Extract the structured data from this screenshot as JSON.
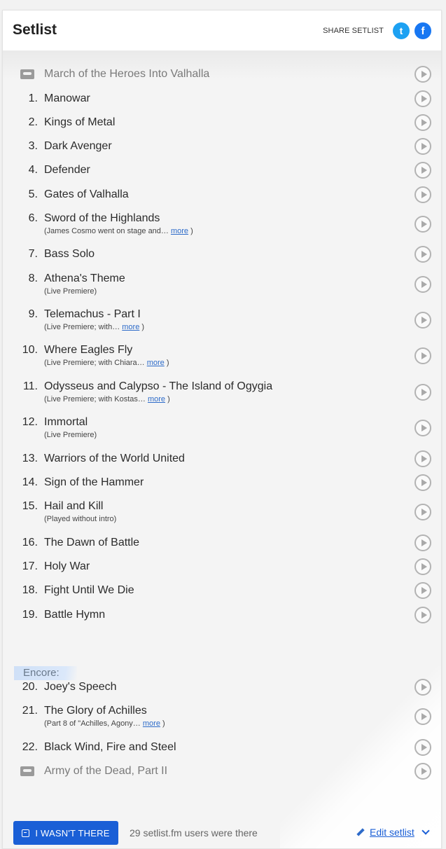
{
  "header": {
    "title": "Setlist",
    "share_label": "SHARE SETLIST",
    "twitter_icon": "t",
    "facebook_icon": "f"
  },
  "setlist": [
    {
      "tape": true,
      "song": "March of the Heroes Into Valhalla"
    },
    {
      "number": "1.",
      "song": "Manowar"
    },
    {
      "number": "2.",
      "song": "Kings of Metal"
    },
    {
      "number": "3.",
      "song": "Dark Avenger"
    },
    {
      "number": "4.",
      "song": "Defender"
    },
    {
      "number": "5.",
      "song": "Gates of Valhalla"
    },
    {
      "number": "6.",
      "song": "Sword of the Highlands",
      "note": "(James Cosmo went on stage and…",
      "more": "more",
      "note_end": ")"
    },
    {
      "number": "7.",
      "song": "Bass Solo"
    },
    {
      "number": "8.",
      "song": "Athena's Theme",
      "note": "(Live Premiere)"
    },
    {
      "number": "9.",
      "song": "Telemachus - Part I",
      "note": "(Live Premiere; with…",
      "more": "more",
      "note_end": ")"
    },
    {
      "number": "10.",
      "song": "Where Eagles Fly",
      "note": "(Live Premiere; with Chiara…",
      "more": "more",
      "note_end": ")"
    },
    {
      "number": "11.",
      "song": "Odysseus and Calypso - The Island of Ogygia",
      "note": "(Live Premiere; with Kostas…",
      "more": "more",
      "note_end": ")"
    },
    {
      "number": "12.",
      "song": "Immortal",
      "note": "(Live Premiere)"
    },
    {
      "number": "13.",
      "song": "Warriors of the World United"
    },
    {
      "number": "14.",
      "song": "Sign of the Hammer"
    },
    {
      "number": "15.",
      "song": "Hail and Kill",
      "note": "(Played without intro)"
    },
    {
      "number": "16.",
      "song": "The Dawn of Battle"
    },
    {
      "number": "17.",
      "song": "Holy War"
    },
    {
      "number": "18.",
      "song": "Fight Until We Die"
    },
    {
      "number": "19.",
      "song": "Battle Hymn"
    }
  ],
  "encore_label": "Encore:",
  "encore": [
    {
      "number": "20.",
      "song": "Joey's Speech"
    },
    {
      "number": "21.",
      "song": "The Glory of Achilles",
      "note": "(Part 8 of \"Achilles, Agony…",
      "more": "more",
      "note_end": ")"
    },
    {
      "number": "22.",
      "song": "Black Wind, Fire and Steel"
    },
    {
      "tape": true,
      "song": "Army of the Dead, Part II"
    }
  ],
  "footer": {
    "wasnt_there_label": "I WASN'T THERE",
    "attendance_text": "29 setlist.fm users were there",
    "edit_label": "Edit setlist"
  }
}
